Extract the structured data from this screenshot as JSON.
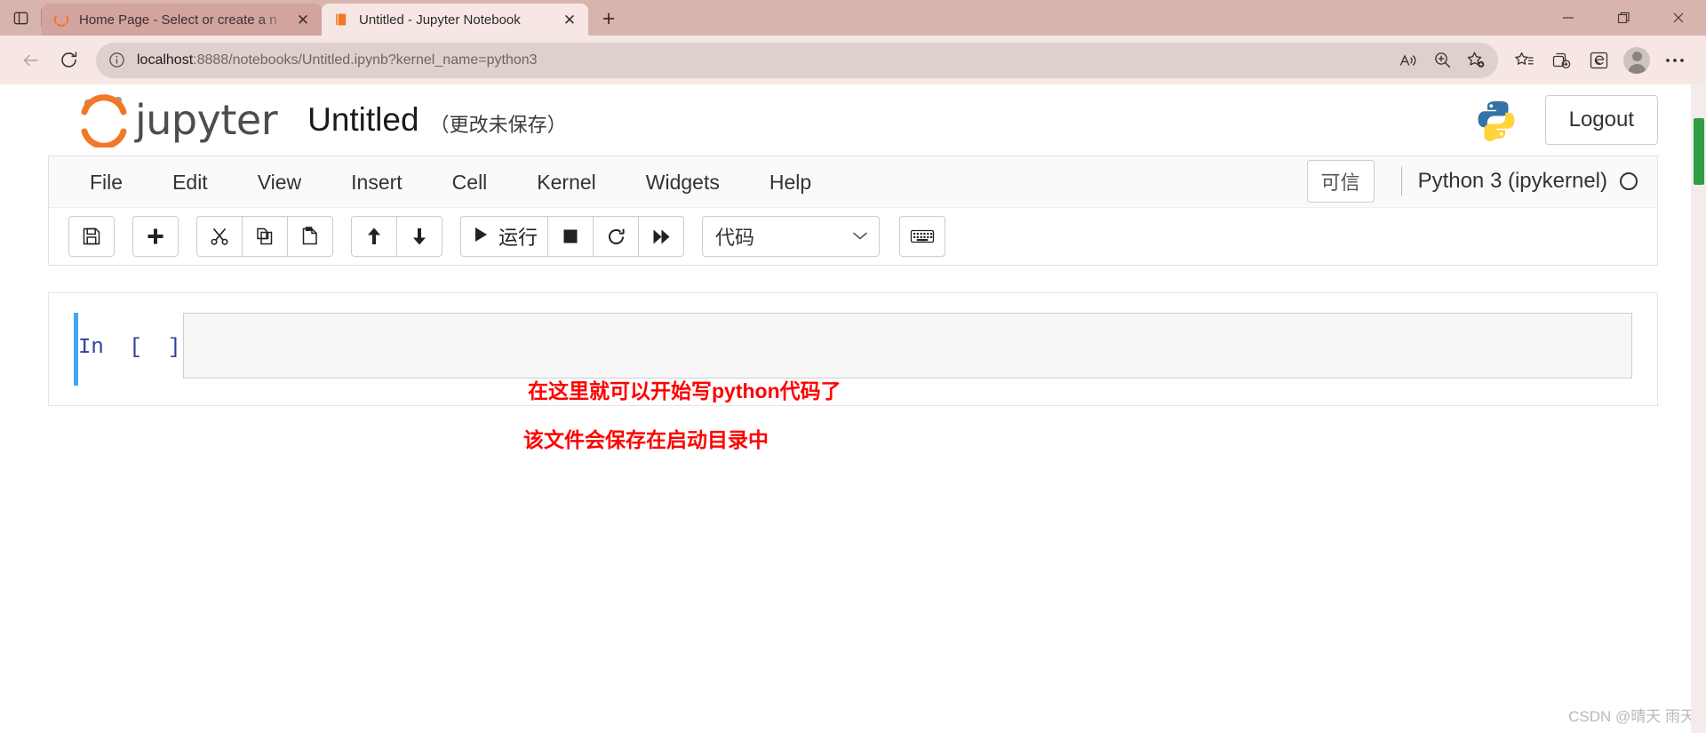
{
  "browser": {
    "tabs": [
      {
        "title": "Home Page - Select or create a n",
        "favicon": "jupyter-spinner-icon",
        "active": false,
        "close_label": "✕"
      },
      {
        "title": "Untitled - Jupyter Notebook",
        "favicon": "jupyter-book-icon",
        "active": true,
        "close_label": "✕"
      }
    ],
    "new_tab_label": "+",
    "tab_list_icon": "tab-list-icon",
    "window_controls": {
      "minimize": "minimize-icon",
      "maximize": "maximize-icon",
      "close": "close-icon"
    },
    "nav": {
      "back_icon": "back-arrow-icon",
      "reload_icon": "reload-icon",
      "site_info_icon": "info-icon",
      "url_host": "localhost",
      "url_rest": ":8888/notebooks/Untitled.ipynb?kernel_name=python3",
      "url_full": "localhost:8888/notebooks/Untitled.ipynb?kernel_name=python3",
      "read_aloud_icon": "read-aloud-icon",
      "zoom_icon": "zoom-in-icon",
      "add_favorite_icon": "add-favorite-star-icon",
      "favorites_icon": "favorites-star-list-icon",
      "collections_icon": "collections-icon",
      "ie_mode_icon": "internet-explorer-icon",
      "profile_icon": "profile-avatar-icon",
      "settings_icon": "more-options-icon"
    }
  },
  "jupyter": {
    "logo_text": "jupyter",
    "notebook_title": "Untitled",
    "dirty_label": "（更改未保存）",
    "python_logo": "python-logo-icon",
    "logout_label": "Logout",
    "menus": [
      {
        "label": "File"
      },
      {
        "label": "Edit"
      },
      {
        "label": "View"
      },
      {
        "label": "Insert"
      },
      {
        "label": "Cell"
      },
      {
        "label": "Kernel"
      },
      {
        "label": "Widgets"
      },
      {
        "label": "Help"
      }
    ],
    "trust_badge": "可信",
    "kernel_name": "Python 3 (ipykernel)",
    "kernel_status_icon": "kernel-idle-circle-icon",
    "toolbar": {
      "save_icon": "save-floppy-icon",
      "insert_icon": "add-cell-plus-icon",
      "cut_icon": "scissors-cut-icon",
      "copy_icon": "copy-icon",
      "paste_icon": "paste-icon",
      "move_up_icon": "arrow-up-icon",
      "move_down_icon": "arrow-down-icon",
      "run_icon": "run-play-icon",
      "run_label": "运行",
      "stop_icon": "stop-square-icon",
      "restart_icon": "restart-kernel-icon",
      "restart_run_all_icon": "fast-forward-icon",
      "cell_type_value": "代码",
      "cell_type_caret": "▾",
      "command_palette_icon": "keyboard-icon"
    },
    "cell": {
      "prompt": "In  [  ]:",
      "code_value": ""
    },
    "annotations": [
      "在这里就可以开始写python代码了",
      "该文件会保存在启动目录中"
    ]
  },
  "watermark": "CSDN @晴天 雨天",
  "colors": {
    "browser_chrome": "#d8b4ae",
    "active_tab": "#f6e7e4",
    "jupyter_orange": "#f37726",
    "annotation_red": "#ff0000",
    "cell_selected_blue": "#42a5f5",
    "prompt_indigo": "#303f9f"
  }
}
